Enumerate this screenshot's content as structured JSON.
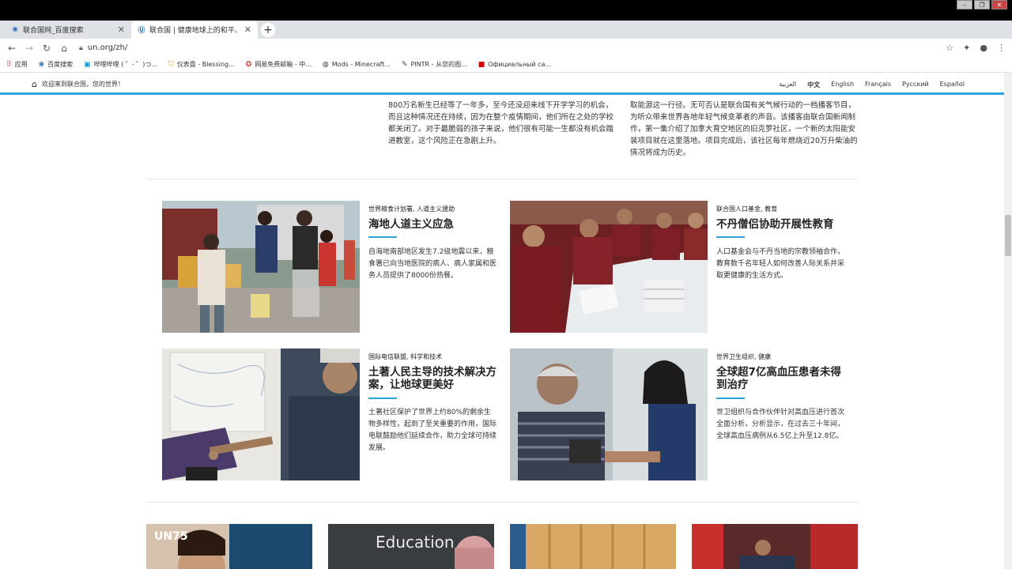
{
  "browser": {
    "tabs": [
      {
        "label": "联合国网_百度搜索",
        "active": false
      },
      {
        "label": "联合国 | 健康地球上的和平、尊严与平等",
        "active": true
      }
    ],
    "url": "un.org/zh/",
    "bookmarks": [
      {
        "label": "应用",
        "icon": "apps-icon"
      },
      {
        "label": "百度搜索",
        "icon": "baidu-icon"
      },
      {
        "label": "哔哩哔哩 ( ゜- ゜)つ...",
        "icon": "bilibili-icon"
      },
      {
        "label": "仪表盘 - Blessing...",
        "icon": "shield-icon"
      },
      {
        "label": "网易免费邮箱 - 中...",
        "icon": "netease-icon"
      },
      {
        "label": "Mods - Minecraft...",
        "icon": "globe-icon"
      },
      {
        "label": "PINTR - 从您的图...",
        "icon": "pen-icon"
      },
      {
        "label": "Официальный са...",
        "icon": "red-icon"
      }
    ]
  },
  "site": {
    "welcome": "欢迎来到联合国，您的世界！",
    "languages": [
      "العربية",
      "中文",
      "English",
      "Français",
      "Русский",
      "Español"
    ],
    "current_language": "中文"
  },
  "previous_text": {
    "left": "800万名新生已经等了一年多，至今还没迎来线下开学学习的机会，而且这种情况还在持续，因为在整个疫情期间，他们所在之处的学校都关闭了。对于最脆弱的孩子来说，他们很有可能一生都没有机会踏进教室，这个风险正在急剧上升。",
    "right": "取能源这一行径。无可否认是联合国有关气候行动的一档播客节目，为听众带来世界各地年轻气候变革者的声音。该播客由联合国新闻制作，第一集介绍了加拿大育空地区的旧克罗社区，一个新的太阳能安装项目就在这里落地。项目完成后，该社区每年燃烧近20万升柴油的情况将成为历史。"
  },
  "cards": [
    {
      "meta": "世界粮食计划署, 人道主义援助",
      "title": "海地人道主义应急",
      "body": "自海地南部地区发生7.2级地震以来，粮食署已向当地医院的病人、病人家属和医务人员提供了8000份热餐。"
    },
    {
      "meta": "联合国人口基金, 教育",
      "title": "不丹僧侣协助开展性教育",
      "body": "人口基金会与不丹当地的宗教领袖合作，教育数千名年轻人如何改善人际关系并采取更健康的生活方式。"
    },
    {
      "meta": "国际电信联盟, 科学和技术",
      "title": "土著人民主导的技术解决方案，让地球更美好",
      "body": "土著社区保护了世界上约80%的剩余生物多样性，起到了至关重要的作用，国际电联鼓励他们延续合作，助力全球可持续发展。"
    },
    {
      "meta": "世界卫生组织, 健康",
      "title": "全球超7亿高血压患者未得到治疗",
      "body": "世卫组织与合作伙伴针对高血压进行首次全面分析，分析显示，在过去三十年间，全球高血压病例从6.5亿上升至12.8亿。"
    }
  ],
  "bottom_thumbs": [
    {
      "logo": "UN75"
    },
    {
      "logo": "Education"
    },
    {
      "logo": ""
    },
    {
      "logo": ""
    }
  ],
  "colors": {
    "accent": "#2fa3d9"
  }
}
